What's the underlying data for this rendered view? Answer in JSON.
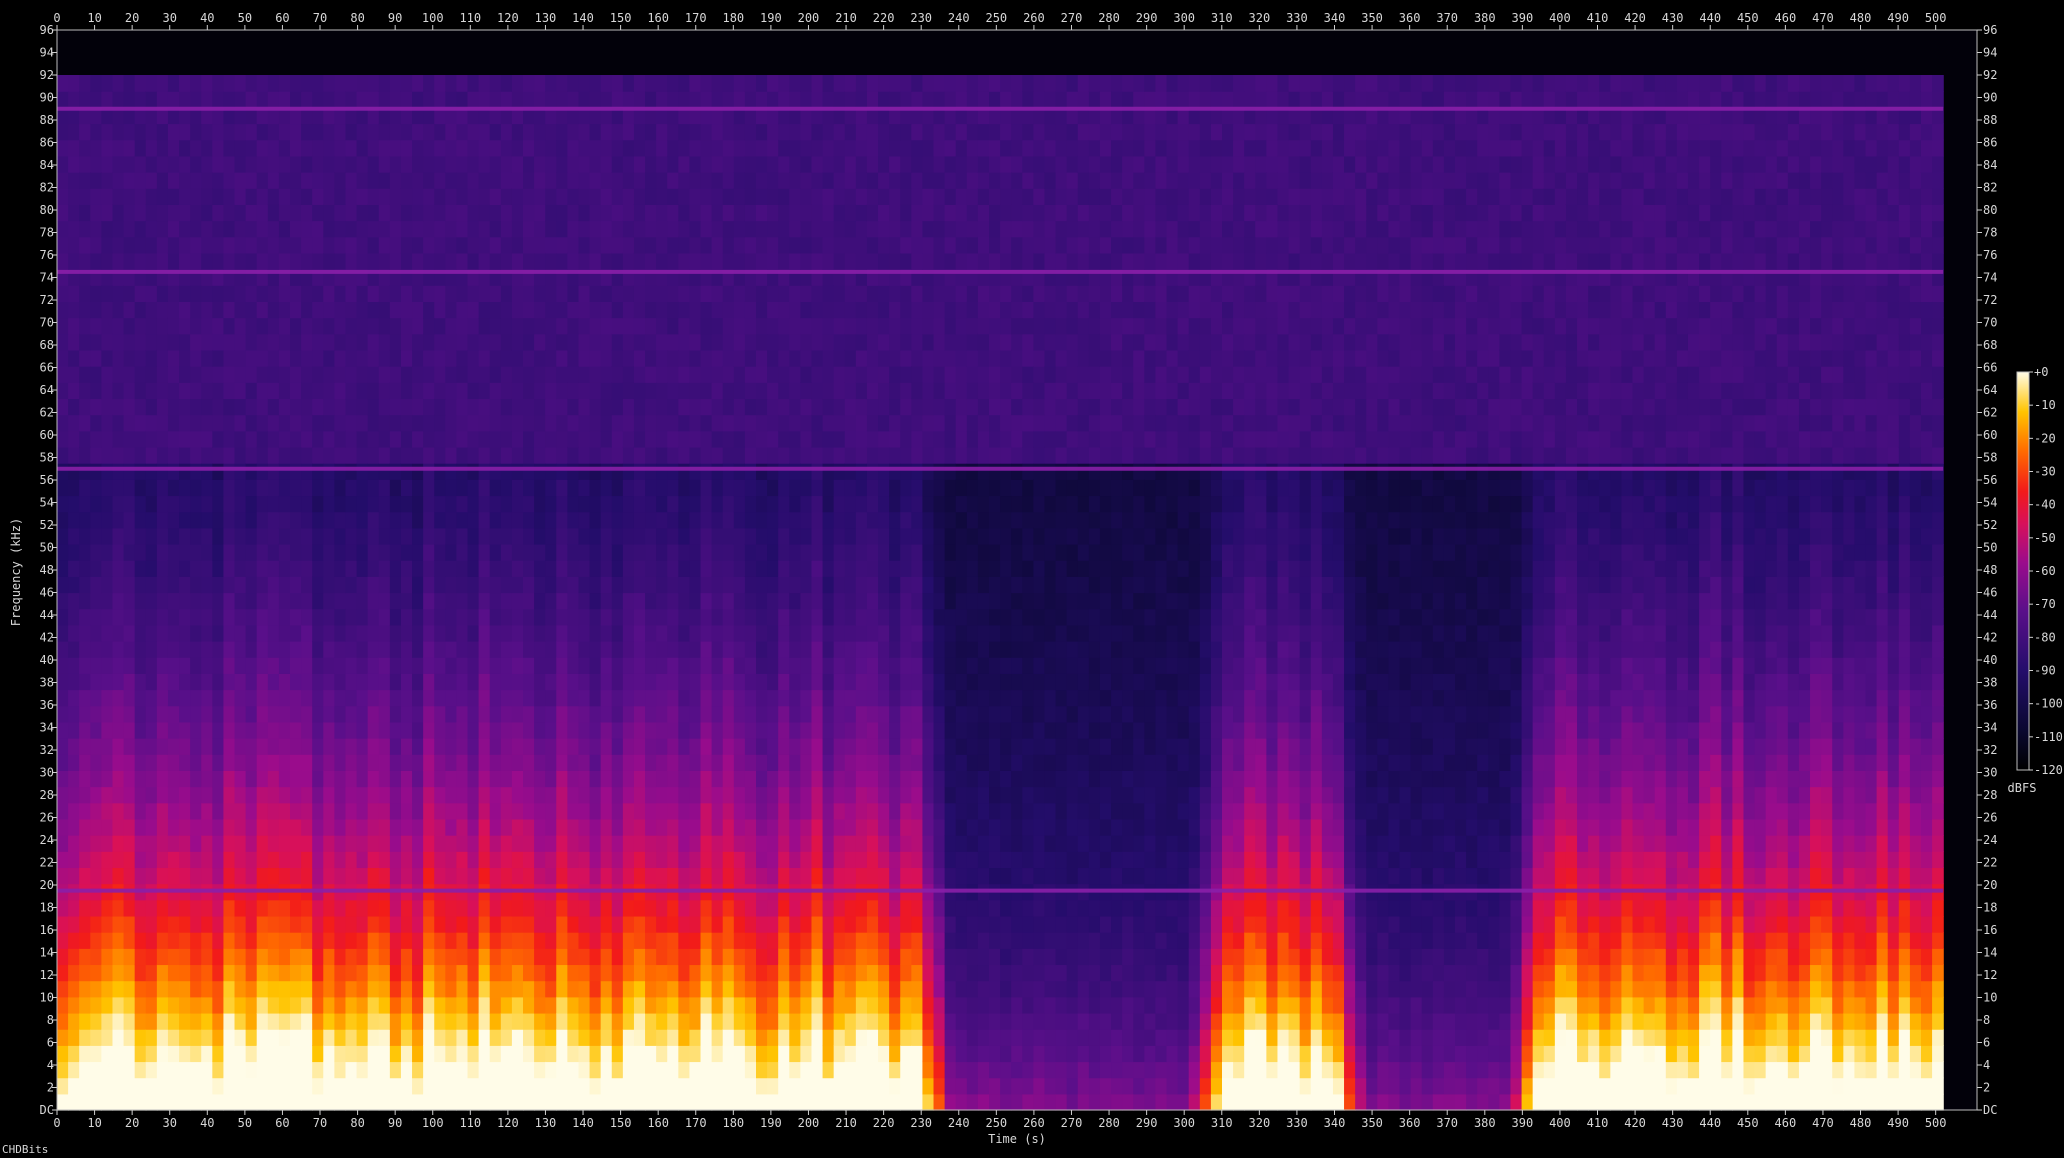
{
  "chart_data": {
    "type": "heatmap",
    "title": "",
    "xlabel": "Time (s)",
    "ylabel": "Frequency (kHz)",
    "xlim": [
      0,
      511
    ],
    "ylim": [
      0,
      96
    ],
    "x_ticks": [
      0,
      10,
      20,
      30,
      40,
      50,
      60,
      70,
      80,
      90,
      100,
      110,
      120,
      130,
      140,
      150,
      160,
      170,
      180,
      190,
      200,
      210,
      220,
      230,
      240,
      250,
      260,
      270,
      280,
      290,
      300,
      310,
      320,
      330,
      340,
      350,
      360,
      370,
      380,
      390,
      400,
      410,
      420,
      430,
      440,
      450,
      460,
      470,
      480,
      490,
      500
    ],
    "y_ticks": [
      0,
      2,
      4,
      6,
      8,
      10,
      12,
      14,
      16,
      18,
      20,
      22,
      24,
      26,
      28,
      30,
      32,
      34,
      36,
      38,
      40,
      42,
      44,
      46,
      48,
      50,
      52,
      54,
      56,
      58,
      60,
      62,
      64,
      66,
      68,
      70,
      72,
      74,
      76,
      78,
      80,
      82,
      84,
      86,
      88,
      90,
      92,
      94,
      96
    ],
    "y_tick_zero_label": "DC",
    "colorbar": {
      "label": "dBFS",
      "ticks": [
        "+0",
        "-10",
        "-20",
        "-30",
        "-40",
        "-50",
        "-60",
        "-70",
        "-80",
        "-90",
        "-100",
        "-110",
        "-120"
      ],
      "range": [
        -120,
        0
      ]
    },
    "signal_extent_khz": 92,
    "audio_end_s": 502,
    "persistent_tones_khz": [
      89,
      74.5,
      57,
      19.5
    ],
    "loud_segments_s": [
      [
        0,
        120
      ],
      [
        120,
        230
      ],
      [
        310,
        340
      ],
      [
        395,
        502
      ]
    ],
    "quiet_segments_s": [
      [
        230,
        310
      ],
      [
        340,
        395
      ]
    ]
  },
  "footer": {
    "text": "CHDBits"
  }
}
